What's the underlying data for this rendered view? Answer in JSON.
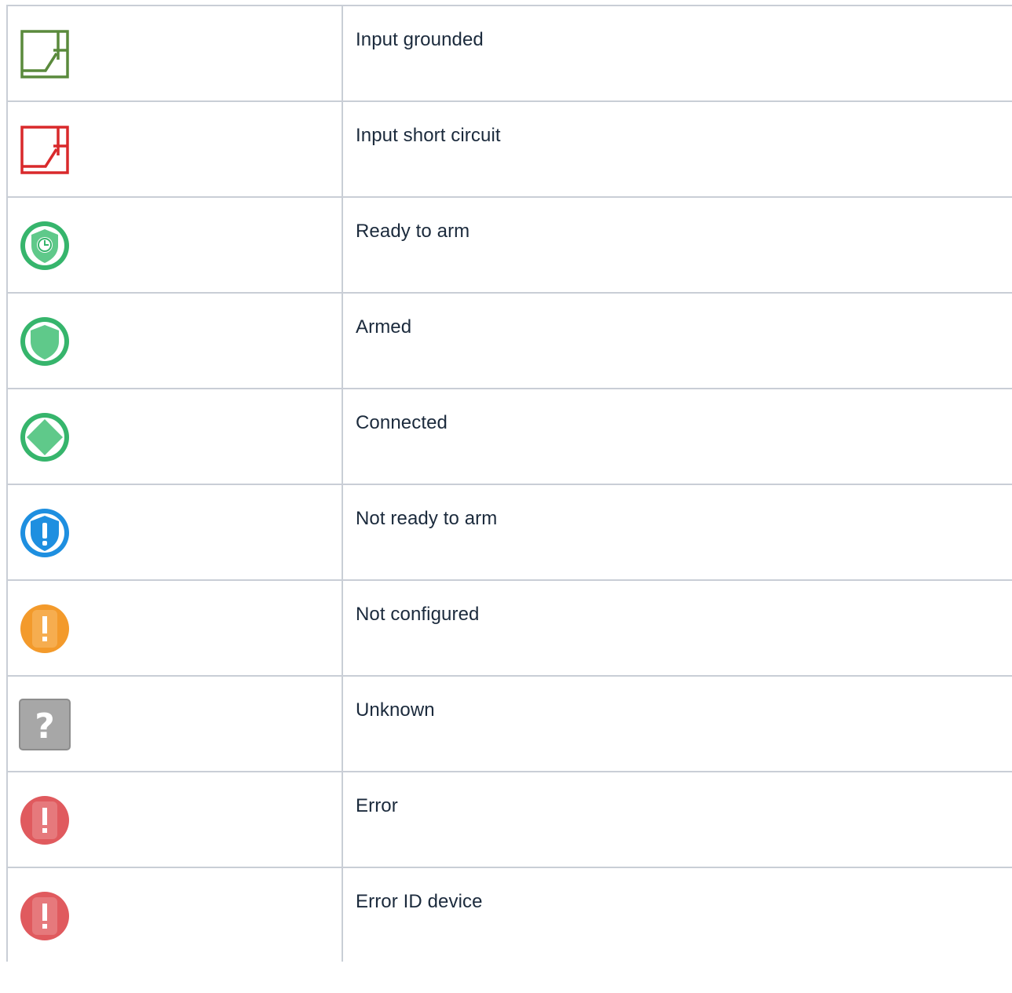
{
  "rows": [
    {
      "icon": "input-grounded-icon",
      "label": "Input grounded",
      "color": "#5a8a3c"
    },
    {
      "icon": "input-short-circuit-icon",
      "label": "Input short circuit",
      "color": "#d9292b"
    },
    {
      "icon": "ready-to-arm-icon",
      "label": "Ready to arm",
      "color": "#36b56c"
    },
    {
      "icon": "armed-icon",
      "label": "Armed",
      "color": "#36b56c"
    },
    {
      "icon": "connected-icon",
      "label": "Connected",
      "color": "#36b56c"
    },
    {
      "icon": "not-ready-to-arm-icon",
      "label": "Not ready to arm",
      "color": "#1e8fe0"
    },
    {
      "icon": "not-configured-icon",
      "label": "Not configured",
      "color": "#f39a2b"
    },
    {
      "icon": "unknown-icon",
      "label": "Unknown",
      "color": "#a7a7a7"
    },
    {
      "icon": "error-icon",
      "label": "Error",
      "color": "#e05a5e"
    },
    {
      "icon": "error-id-device-icon",
      "label": "Error ID device",
      "color": "#e05a5e"
    }
  ]
}
